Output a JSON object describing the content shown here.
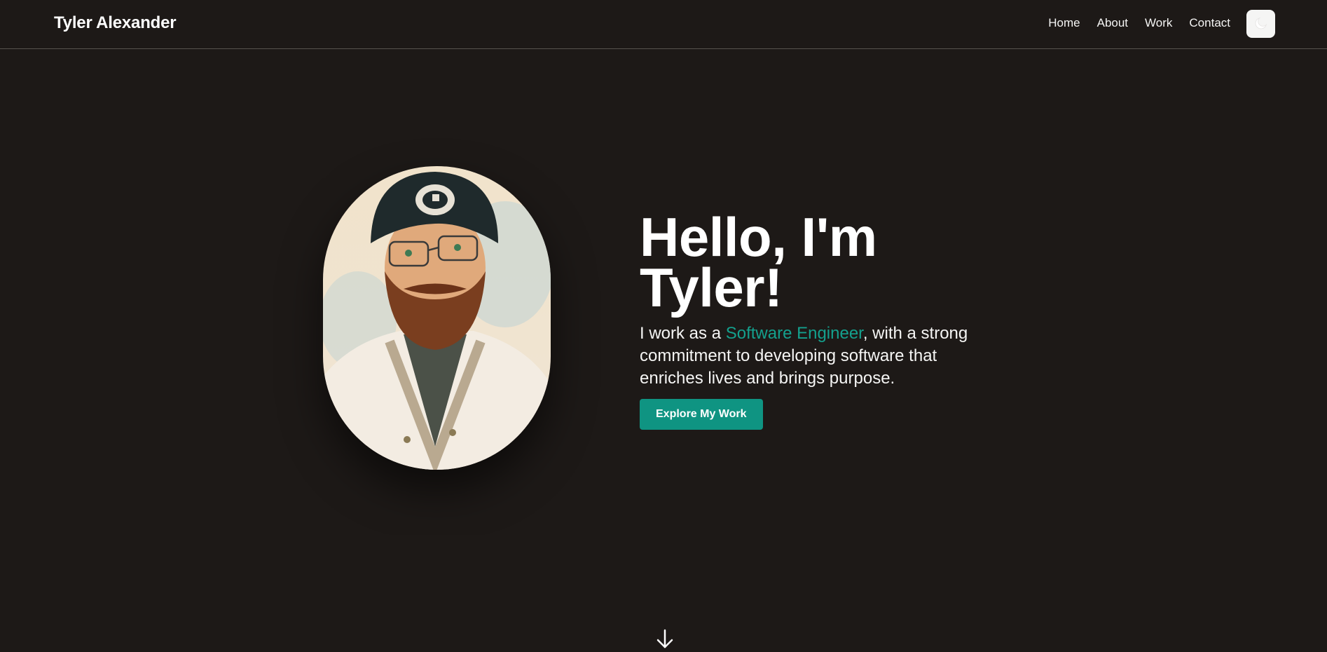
{
  "header": {
    "brand": "Tyler Alexander",
    "nav": [
      {
        "label": "Home"
      },
      {
        "label": "About"
      },
      {
        "label": "Work"
      },
      {
        "label": "Contact"
      }
    ],
    "theme_toggle_icon": "moon-icon"
  },
  "hero": {
    "title_line1": "Hello, I'm",
    "title_line2": "Tyler!",
    "subtitle_prefix": "I work as a ",
    "subtitle_highlight": "Software Engineer",
    "subtitle_suffix": ", with a strong commitment to developing software that enriches lives and brings purpose.",
    "cta_label": "Explore My Work",
    "portrait_icon": "portrait-illustration",
    "scroll_icon": "arrow-down-icon"
  },
  "colors": {
    "background": "#1d1917",
    "accent": "#14a08d",
    "button": "#0f9482",
    "text": "#f5f5f4"
  }
}
